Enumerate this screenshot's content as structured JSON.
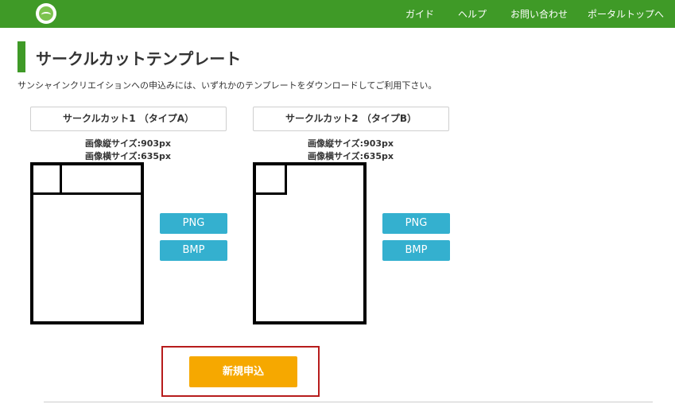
{
  "header": {
    "nav": [
      "ガイド",
      "ヘルプ",
      "お問い合わせ",
      "ポータルトップへ"
    ]
  },
  "page": {
    "title": "サークルカットテンプレート",
    "intro": "サンシャインクリエイションへの申込みには、いずれかのテンプレートをダウンロードしてご利用下さい。"
  },
  "templates": [
    {
      "title": "サークルカット1 （タイプA）",
      "height_label": "画像縦サイズ:903px",
      "width_label": "画像横サイズ:635px",
      "png_label": "PNG",
      "bmp_label": "BMP"
    },
    {
      "title": "サークルカット2 （タイプB）",
      "height_label": "画像縦サイズ:903px",
      "width_label": "画像横サイズ:635px",
      "png_label": "PNG",
      "bmp_label": "BMP"
    }
  ],
  "actions": {
    "new_application": "新規申込"
  },
  "colors": {
    "header_green": "#3f9a27",
    "download_blue": "#34b0cf",
    "apply_orange": "#f6a800",
    "highlight_red": "#b71c1c"
  }
}
